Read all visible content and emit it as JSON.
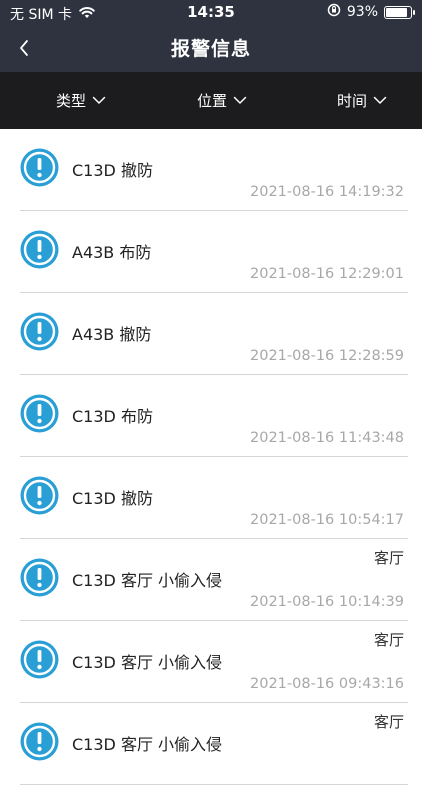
{
  "status_bar": {
    "carrier": "无 SIM 卡",
    "time": "14:35",
    "battery_percent": "93%",
    "battery_level": 0.93
  },
  "header": {
    "title": "报警信息"
  },
  "filters": [
    {
      "label": "类型"
    },
    {
      "label": "位置"
    },
    {
      "label": "时间"
    }
  ],
  "alarms": [
    {
      "title": "C13D 撤防",
      "location": "",
      "time": "2021-08-16 14:19:32"
    },
    {
      "title": "A43B 布防",
      "location": "",
      "time": "2021-08-16 12:29:01"
    },
    {
      "title": "A43B 撤防",
      "location": "",
      "time": "2021-08-16 12:28:59"
    },
    {
      "title": "C13D 布防",
      "location": "",
      "time": "2021-08-16 11:43:48"
    },
    {
      "title": "C13D 撤防",
      "location": "",
      "time": "2021-08-16 10:54:17"
    },
    {
      "title": "C13D 客厅 小偷入侵",
      "location": "客厅",
      "time": "2021-08-16 10:14:39"
    },
    {
      "title": "C13D 客厅 小偷入侵",
      "location": "客厅",
      "time": "2021-08-16 09:43:16"
    },
    {
      "title": "C13D 客厅 小偷入侵",
      "location": "客厅",
      "time": ""
    }
  ],
  "colors": {
    "header_bg": "#2f3340",
    "filter_bg": "#1c1c1e",
    "alert_icon": "#2a9fd6"
  },
  "icons": {
    "back": "chevron-left-icon",
    "dropdown": "chevron-down-icon",
    "alert": "exclamation-circle-icon",
    "wifi": "wifi-icon",
    "orientation_lock": "orientation-lock-icon",
    "battery": "battery-icon"
  }
}
